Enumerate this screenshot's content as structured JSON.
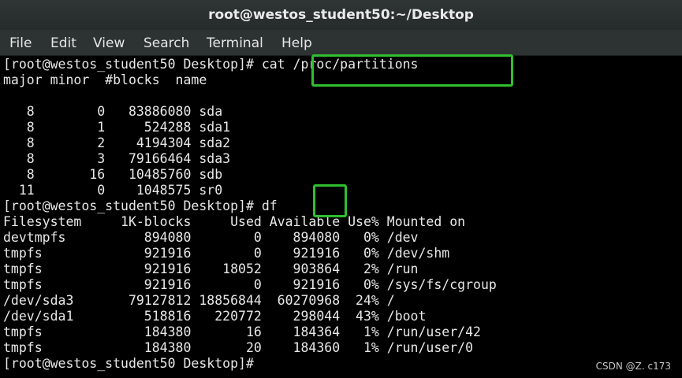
{
  "window": {
    "title": "root@westos_student50:~/Desktop"
  },
  "menu": [
    "File",
    "Edit",
    "View",
    "Search",
    "Terminal",
    "Help"
  ],
  "terminal": {
    "lines": [
      "[root@westos_student50 Desktop]# cat /proc/partitions",
      "major minor  #blocks  name",
      "",
      "   8        0   83886080 sda",
      "   8        1     524288 sda1",
      "   8        2    4194304 sda2",
      "   8        3   79166464 sda3",
      "   8       16   10485760 sdb",
      "  11        0    1048575 sr0",
      "[root@westos_student50 Desktop]# df",
      "Filesystem     1K-blocks     Used Available Use% Mounted on",
      "devtmpfs          894080        0    894080   0% /dev",
      "tmpfs             921916        0    921916   0% /dev/shm",
      "tmpfs             921916    18052    903864   2% /run",
      "tmpfs             921916        0    921916   0% /sys/fs/cgroup",
      "/dev/sda3       79127812 18856844  60270968  24% /",
      "/dev/sda1         518816   220772    298044  43% /boot",
      "tmpfs             184380       16    184364   1% /run/user/42",
      "tmpfs             184380       20    184360   1% /run/user/0",
      "[root@westos_student50 Desktop]#"
    ]
  },
  "watermark": "CSDN @Z. c173",
  "colors": {
    "highlight": "#2fbf2f",
    "background": "#000000",
    "text": "#e8e8e8"
  }
}
